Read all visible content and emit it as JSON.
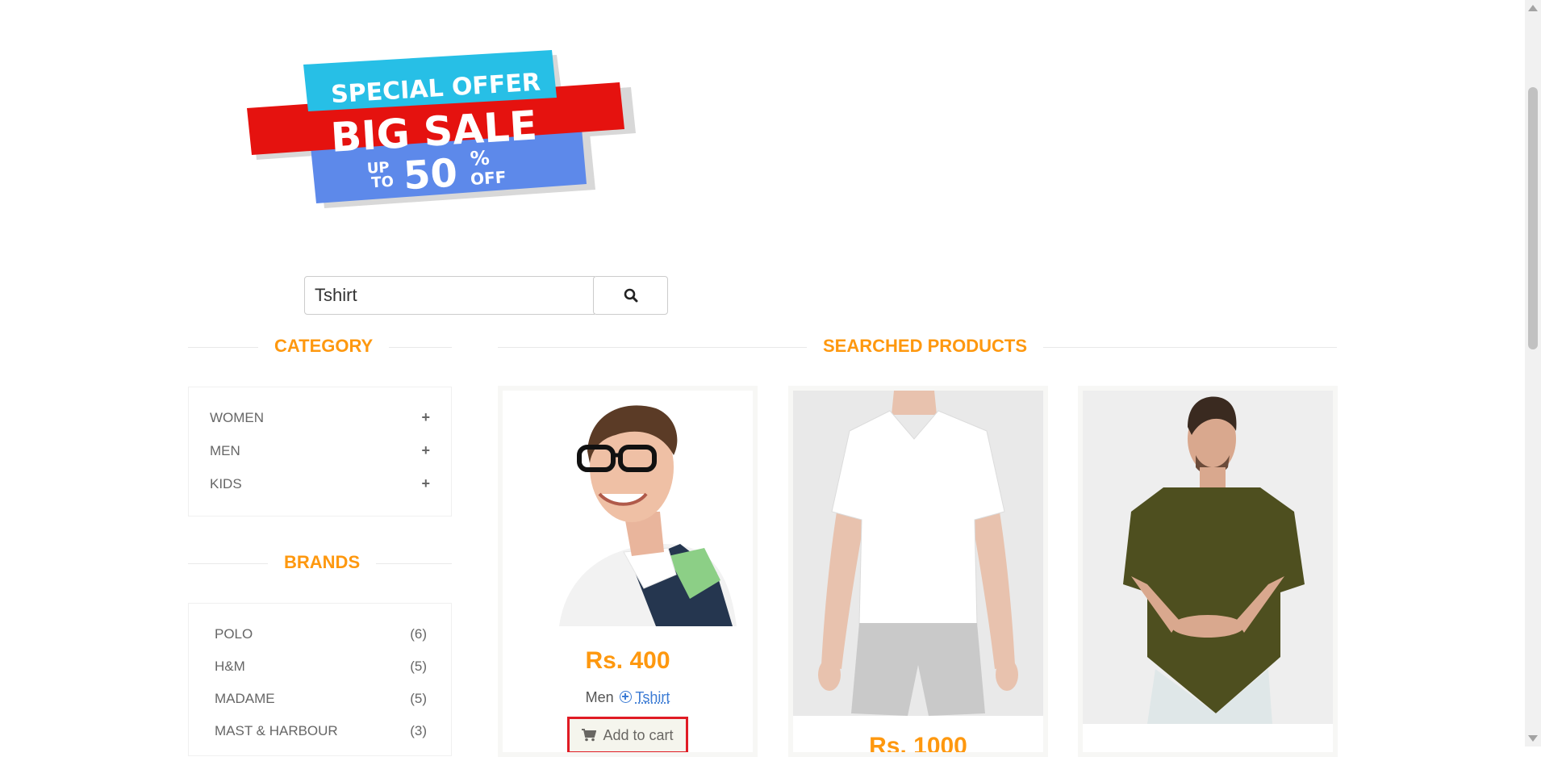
{
  "banner": {
    "line1": "SPECIAL OFFER",
    "line2": "BIG SALE",
    "upto": "UP",
    "to": "TO",
    "percent": "50",
    "pct_sign": "%",
    "off": "OFF"
  },
  "search": {
    "value": "Tshirt"
  },
  "category": {
    "title": "CATEGORY",
    "items": [
      {
        "label": "WOMEN",
        "icon": "+"
      },
      {
        "label": "MEN",
        "icon": "+"
      },
      {
        "label": "KIDS",
        "icon": "+"
      }
    ]
  },
  "brands": {
    "title": "BRANDS",
    "items": [
      {
        "label": "POLO",
        "count": "(6)"
      },
      {
        "label": "H&M",
        "count": "(5)"
      },
      {
        "label": "MADAME",
        "count": "(5)"
      },
      {
        "label": "MAST & HARBOUR",
        "count": "(3)"
      }
    ]
  },
  "products": {
    "title": "SEARCHED PRODUCTS",
    "items": [
      {
        "price": "Rs. 400",
        "category": "Men",
        "subcategory": "Tshirt",
        "cart_label": "Add to cart"
      },
      {
        "price": "Rs. 1000"
      },
      {
        "price": ""
      }
    ]
  },
  "colors": {
    "accent": "#fe980f",
    "link": "#3b7bd4",
    "cart_border": "#e01b24"
  }
}
